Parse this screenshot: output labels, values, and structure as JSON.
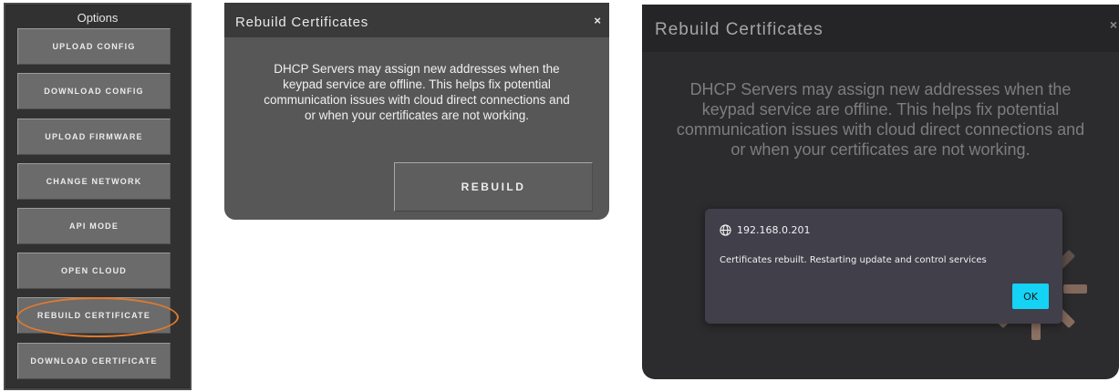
{
  "options_panel": {
    "title": "Options",
    "buttons": [
      {
        "label": "UPLOAD CONFIG"
      },
      {
        "label": "DOWNLOAD CONFIG"
      },
      {
        "label": "UPLOAD FIRMWARE"
      },
      {
        "label": "CHANGE NETWORK"
      },
      {
        "label": "API MODE"
      },
      {
        "label": "OPEN CLOUD"
      },
      {
        "label": "REBUILD CERTIFICATE",
        "highlighted": true
      },
      {
        "label": "DOWNLOAD CERTIFICATE"
      }
    ],
    "highlight_color": "#e07a2e"
  },
  "dialog": {
    "title": "Rebuild Certificates",
    "close_label": "×",
    "body_line1": "DHCP Servers may assign new addresses when the",
    "body_line2": "keypad service are offline. This helps fix potential",
    "body_line3": "communication issues with cloud direct connections and",
    "body_line4": "or when your certificates are not working.",
    "rebuild_label": "REBUILD"
  },
  "dialog_dimmed": {
    "title": "Rebuild Certificates",
    "close_label": "×",
    "body_line1": "DHCP Servers may assign new addresses when the",
    "body_line2": "keypad service are offline. This helps fix potential",
    "body_line3": "communication issues with cloud direct connections and",
    "body_line4": "or when your certificates are not working."
  },
  "notification": {
    "host_icon": "globe-icon",
    "host": "192.168.0.201",
    "message": "Certificates rebuilt.  Restarting update and control services",
    "ok_label": "OK",
    "ok_color": "#14d3f5"
  },
  "spinner": {
    "icon": "loading-spinner-icon",
    "color": "#8c7062"
  }
}
